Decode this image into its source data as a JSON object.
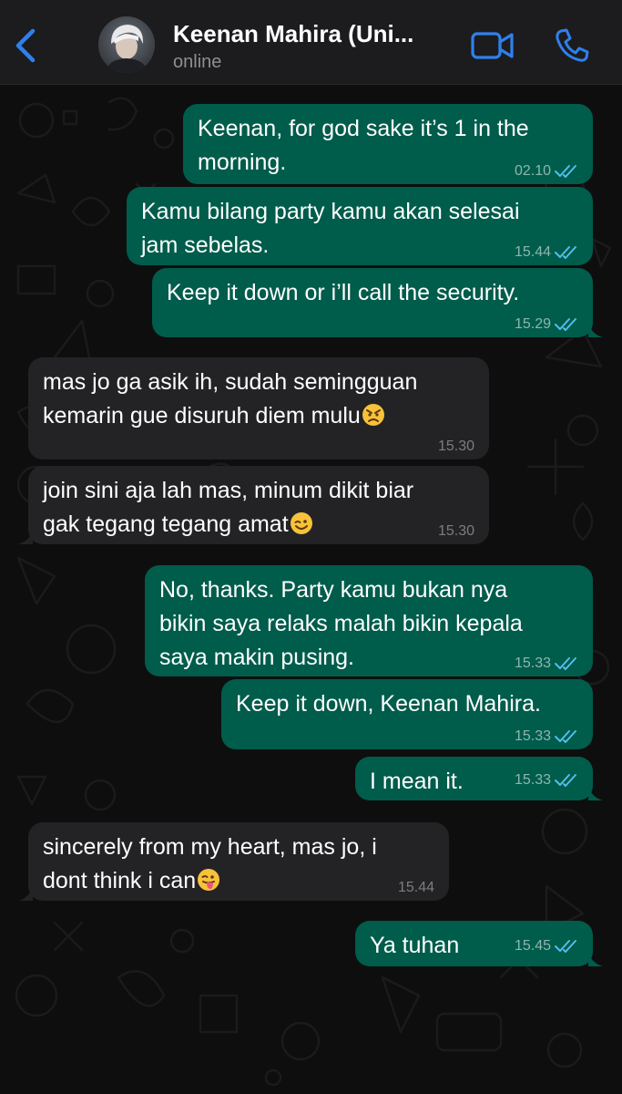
{
  "header": {
    "contact_name": "Keenan Mahira (Uni...",
    "status": "online",
    "back_icon": "chevron-left-icon",
    "video_icon": "video-camera-icon",
    "call_icon": "phone-icon",
    "accent_color": "#2f80ed"
  },
  "messages": [
    {
      "direction": "outgoing",
      "text": "Keenan, for god sake it’s 1 in the\nmorning.",
      "time": "02.10",
      "read": true
    },
    {
      "direction": "outgoing",
      "text": "Kamu bilang party kamu akan selesai\njam sebelas.",
      "time": "15.44",
      "read": true
    },
    {
      "direction": "outgoing",
      "text": "Keep it down or i’ll call the security.",
      "time": "15.29",
      "read": true
    },
    {
      "direction": "incoming",
      "text": "mas jo ga asik ih, sudah semingguan\nkemarin gue disuruh diem mulu",
      "emoji": "angry-face",
      "time": "15.30"
    },
    {
      "direction": "incoming",
      "text": "join sini aja lah mas, minum dikit biar\ngak tegang tegang amat",
      "emoji": "winking-face",
      "time": "15.30"
    },
    {
      "direction": "outgoing",
      "text": "No, thanks. Party kamu bukan nya\nbikin saya relaks malah bikin kepala\nsaya makin pusing.",
      "time": "15.33",
      "read": true
    },
    {
      "direction": "outgoing",
      "text": "Keep it down, Keenan Mahira.",
      "time": "15.33",
      "read": true
    },
    {
      "direction": "outgoing",
      "text": "I mean it.",
      "time": "15.33",
      "read": true
    },
    {
      "direction": "incoming",
      "text": "sincerely from my heart, mas jo, i\ndont think i can",
      "emoji": "face-with-tongue",
      "time": "15.44"
    },
    {
      "direction": "outgoing",
      "text": "Ya tuhan",
      "time": "15.45",
      "read": true
    }
  ],
  "colors": {
    "outgoing_bubble": "#005c4b",
    "incoming_bubble": "#232325",
    "read_ticks": "#53bdeb",
    "header_bg": "#1c1c1e"
  }
}
